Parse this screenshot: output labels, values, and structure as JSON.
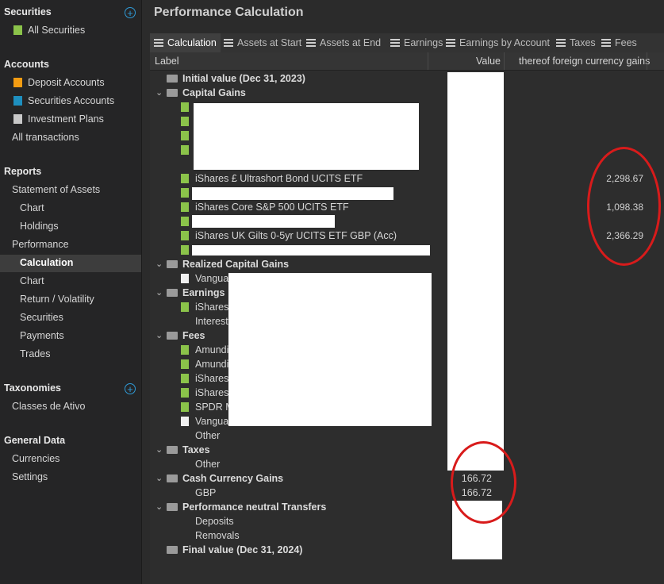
{
  "sidebar": {
    "securities_header": "Securities",
    "all_securities": "All Securities",
    "accounts_header": "Accounts",
    "deposit_accounts": "Deposit Accounts",
    "securities_accounts": "Securities Accounts",
    "investment_plans": "Investment Plans",
    "all_transactions": "All transactions",
    "reports_header": "Reports",
    "statement_of_assets": "Statement of Assets",
    "soa_chart": "Chart",
    "soa_holdings": "Holdings",
    "performance": "Performance",
    "perf_calculation": "Calculation",
    "perf_chart": "Chart",
    "perf_return_volatility": "Return / Volatility",
    "perf_securities": "Securities",
    "perf_payments": "Payments",
    "perf_trades": "Trades",
    "taxonomies_header": "Taxonomies",
    "classes_de_ativo": "Classes de Ativo",
    "general_data_header": "General Data",
    "currencies": "Currencies",
    "settings": "Settings",
    "plus_symbol": "+"
  },
  "main": {
    "title": "Performance Calculation",
    "tabs": [
      "Calculation",
      "Assets at Start",
      "Assets at End",
      "Earnings",
      "Earnings by Account",
      "Taxes",
      "Fees"
    ],
    "columns": {
      "label": "Label",
      "value": "Value",
      "fx": "thereof foreign currency gains"
    }
  },
  "tree": {
    "initial_value": "Initial value (Dec 31, 2023)",
    "capital_gains": "Capital Gains",
    "cg_item_1": "iShares £ Ultrashort Bond UCITS ETF",
    "cg_item_1_fx": "2,298.67",
    "cg_item_2": "iShares Core S&P 500 UCITS ETF",
    "cg_item_2_fx": "1,098.38",
    "cg_item_3": "iShares UK Gilts 0-5yr UCITS ETF GBP (Acc)",
    "cg_item_3_fx": "2,366.29",
    "realized_capital_gains": "Realized Capital Gains",
    "rcg_item_1": "Vanguar",
    "earnings": "Earnings",
    "earn_item_1": "iShares",
    "earn_item_2": "Interest",
    "fees": "Fees",
    "fee_item_1": "Amundi",
    "fee_item_2": "Amundi",
    "fee_item_3": "iShares",
    "fee_item_4": "iShares",
    "fee_item_5": "SPDR M",
    "fee_item_6": "Vanguar",
    "fee_other": "Other",
    "taxes": "Taxes",
    "tax_other": "Other",
    "cash_currency_gains": "Cash Currency Gains",
    "ccg_value": "166.72",
    "gbp": "GBP",
    "gbp_value": "166.72",
    "performance_neutral_transfers": "Performance neutral Transfers",
    "deposits": "Deposits",
    "removals": "Removals",
    "final_value": "Final value (Dec 31, 2024)"
  },
  "colors": {
    "accent": "#2f9ad6",
    "annotation": "#d81b1b",
    "leaf_green": "#8bc34a"
  }
}
